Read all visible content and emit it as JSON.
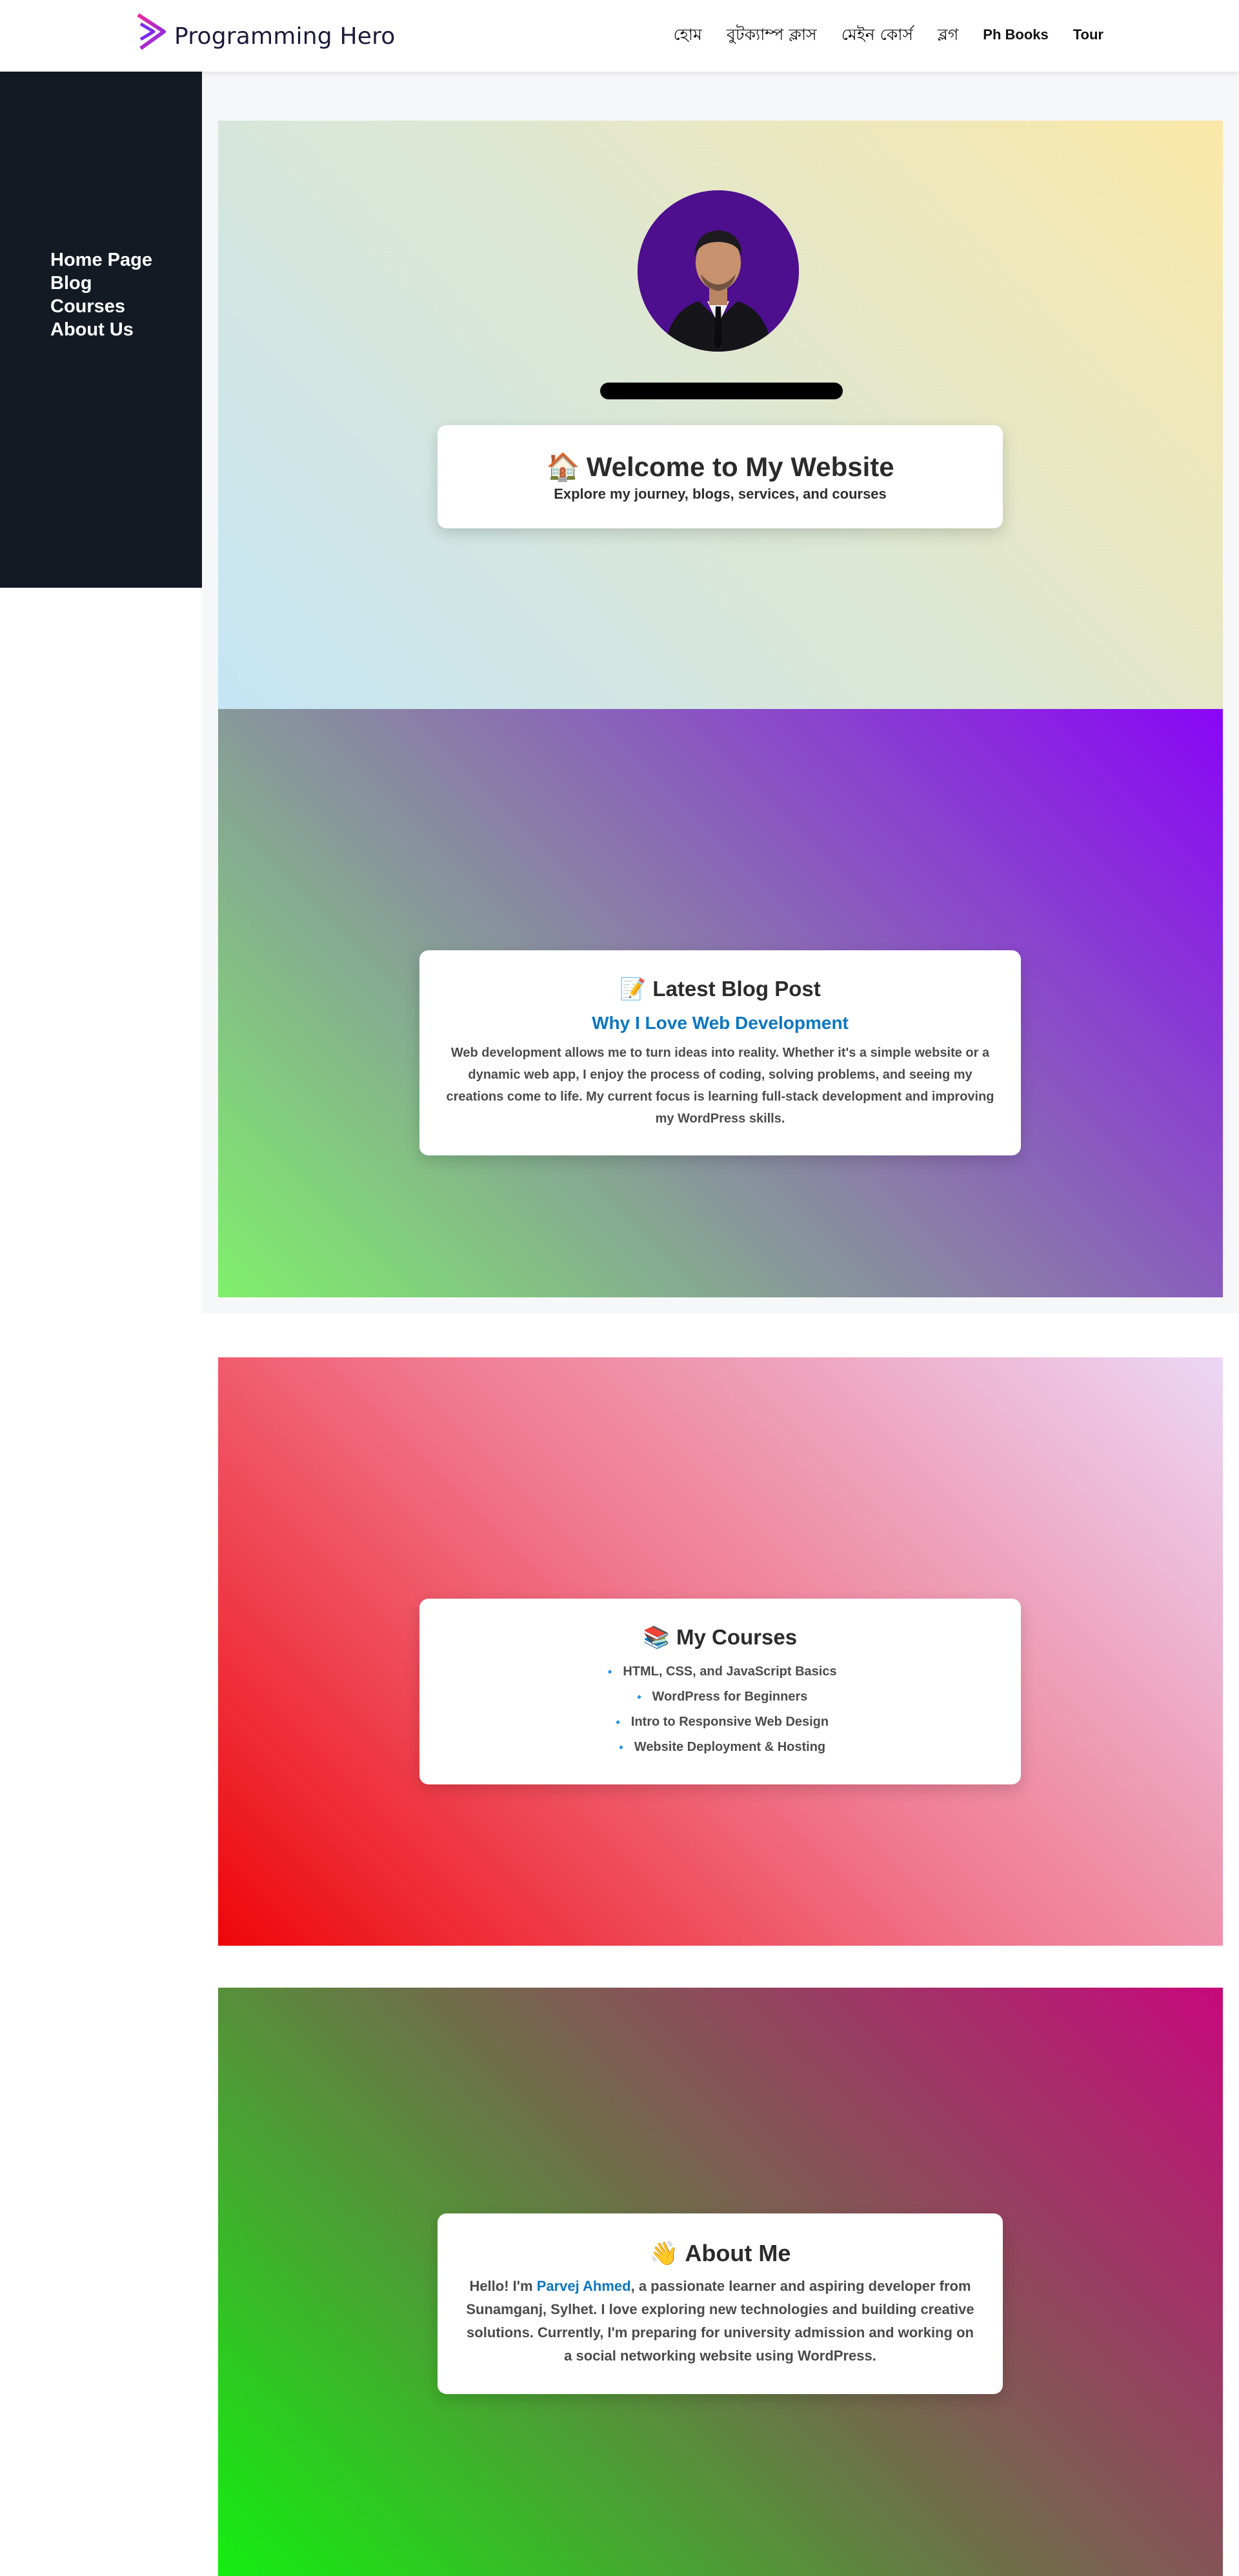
{
  "header": {
    "brand": "Programming Hero",
    "nav": [
      {
        "label": "হোম"
      },
      {
        "label": "বুটক্যাম্প ক্লাস"
      },
      {
        "label": "মেইন কোর্স"
      },
      {
        "label": "ব্লগ"
      },
      {
        "label": "Ph Books"
      },
      {
        "label": "Tour"
      }
    ]
  },
  "sidebar": {
    "items": [
      {
        "label": "Home Page"
      },
      {
        "label": "Blog"
      },
      {
        "label": "Courses"
      },
      {
        "label": "About Us"
      }
    ]
  },
  "home": {
    "icon": "🏠",
    "title": "Welcome to My Website",
    "subtitle": "Explore my journey, blogs, services, and courses"
  },
  "blog": {
    "icon": "📝",
    "heading": "Latest Blog Post",
    "post_title": "Why I Love Web Development",
    "post_body": "Web development allows me to turn ideas into reality. Whether it's a simple website or a dynamic web app, I enjoy the process of coding, solving problems, and seeing my creations come to life. My current focus is learning full-stack development and improving my WordPress skills."
  },
  "courses": {
    "icon": "📚",
    "heading": "My Courses",
    "bullet": "🔹",
    "items": [
      "HTML, CSS, and JavaScript Basics",
      "WordPress for Beginners",
      "Intro to Responsive Web Design",
      "Website Deployment & Hosting"
    ]
  },
  "about": {
    "icon": "👋",
    "heading": "About Me",
    "intro": "Hello! I'm ",
    "name": "Parvej Ahmed",
    "body": ", a passionate learner and aspiring developer from Sunamganj, Sylhet. I love exploring new technologies and building creative solutions. Currently, I'm preparing for university admission and working on a social networking website using WordPress."
  },
  "colors": {
    "sidebar_bg": "#141a24",
    "accent_link": "#0b76c0",
    "avatar_bg": "#4d0f8e",
    "brand_gradient": [
      "#f02d9b",
      "#7a2cf0"
    ]
  }
}
